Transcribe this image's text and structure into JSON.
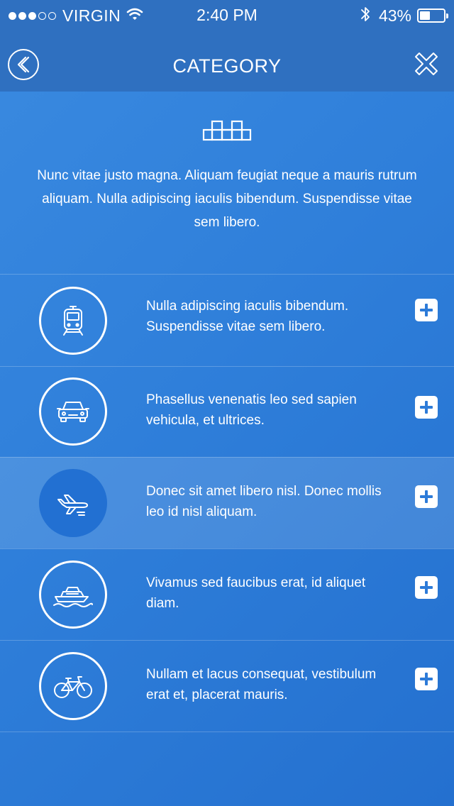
{
  "status_bar": {
    "carrier": "VIRGIN",
    "signal_strength": 3,
    "signal_max": 5,
    "time": "2:40 PM",
    "battery_percent": "43%",
    "battery_level": 0.43
  },
  "nav": {
    "title": "CATEGORY",
    "back_icon": "chevron-left-circle-icon",
    "close_icon": "close-x-icon"
  },
  "hero": {
    "icon": "taxi-sign-icon",
    "description": "Nunc vitae justo magna. Aliquam feugiat neque a mauris rutrum aliquam. Nulla adipiscing iaculis bibendum. Suspendisse vitae sem libero."
  },
  "items": [
    {
      "icon": "train-icon",
      "text": "Nulla adipiscing iaculis bibendum. Suspendisse vitae sem libero.",
      "active": false
    },
    {
      "icon": "car-icon",
      "text": "Phasellus venenatis leo sed sapien vehicula, et ultrices.",
      "active": false
    },
    {
      "icon": "airplane-icon",
      "text": "Donec sit amet libero nisl. Donec mollis leo id nisl aliquam.",
      "active": true
    },
    {
      "icon": "boat-icon",
      "text": "Vivamus sed faucibus erat, id aliquet diam.",
      "active": false
    },
    {
      "icon": "bicycle-icon",
      "text": "Nullam et lacus consequat, vestibulum erat et, placerat mauris.",
      "active": false
    }
  ],
  "colors": {
    "background": "#2f7fda",
    "navbar": "#2f70c0",
    "active_circle": "#2270d2",
    "plus_icon": "#2d7bd8"
  }
}
